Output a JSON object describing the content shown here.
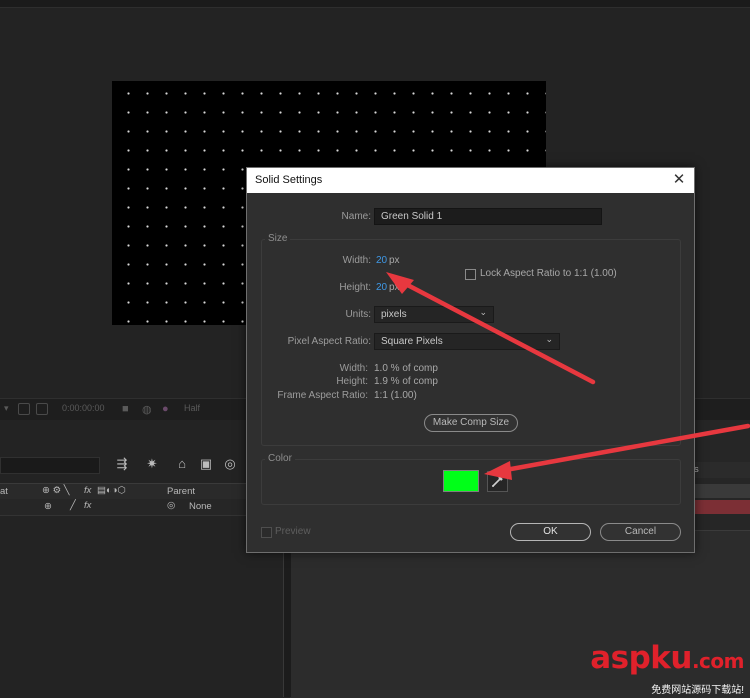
{
  "dialog": {
    "title": "Solid Settings",
    "close": "✕",
    "name_label": "Name:",
    "name_value": "Green Solid 1",
    "size_group": "Size",
    "width_label": "Width:",
    "width_value": "20",
    "height_label": "Height:",
    "height_value": "20",
    "px": "px",
    "lock_label": "Lock Aspect Ratio to 1:1 (1.00)",
    "units_label": "Units:",
    "units_value": "pixels",
    "par_label": "Pixel Aspect Ratio:",
    "par_value": "Square Pixels",
    "comp_width_label": "Width:",
    "comp_width_value": "1.0 % of comp",
    "comp_height_label": "Height:",
    "comp_height_value": "1.9 % of comp",
    "frame_ar_label": "Frame Aspect Ratio:",
    "frame_ar_value": "1:1 (1.00)",
    "make_comp_size": "Make Comp Size",
    "color_group": "Color",
    "color_hex": "#00ff18",
    "preview_label": "Preview",
    "ok": "OK",
    "cancel": "Cancel"
  },
  "background": {
    "viewer_time": "0:00:00:00",
    "viewer_res": "Half",
    "col_at": "at",
    "col_fx": "fx",
    "col_parent": "Parent",
    "row_parent_value": "None",
    "row_fx": "fx",
    "right_header": "s"
  },
  "watermark": {
    "logo": "aspku",
    "suffix": ".com",
    "tagline": "免费网站源码下载站!"
  },
  "colors": {
    "arrow": "#e7383f",
    "accent_blue": "#3f98e6",
    "timeline_row_red": "#7c2f35"
  }
}
